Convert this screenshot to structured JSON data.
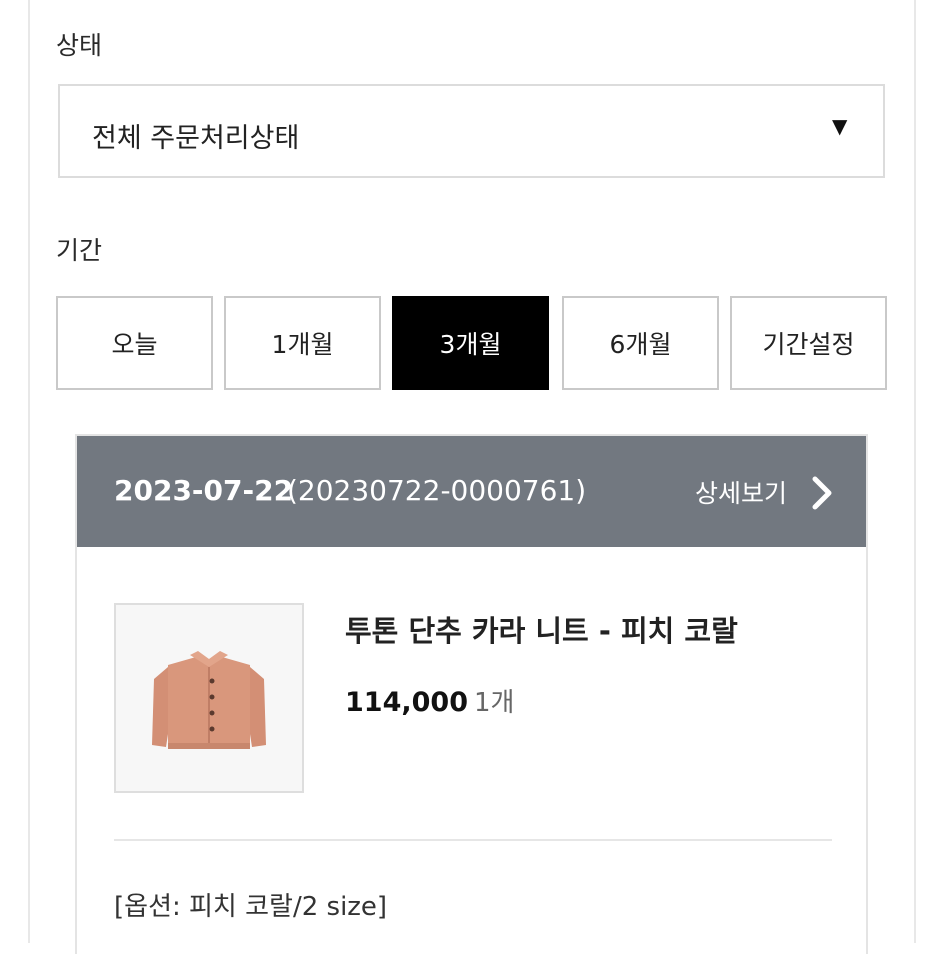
{
  "filters": {
    "status_label": "상태",
    "status_select_value": "전체 주문처리상태",
    "period_label": "기간",
    "period_buttons": [
      "오늘",
      "1개월",
      "3개월",
      "6개월",
      "기간설정"
    ],
    "active_period": "3개월"
  },
  "order": {
    "date": "2023-07-22",
    "order_number": "(20230722-0000761)",
    "detail_link": "상세보기",
    "product_name": "투톤 단추 카라 니트 - 피치 코랄",
    "price": "114,000",
    "quantity": "1개",
    "option": "[옵션: 피치 코랄/2 size]"
  },
  "colors": {
    "header_bg": "#727880",
    "active_button_bg": "#000000",
    "product_color": "#d8957a"
  }
}
